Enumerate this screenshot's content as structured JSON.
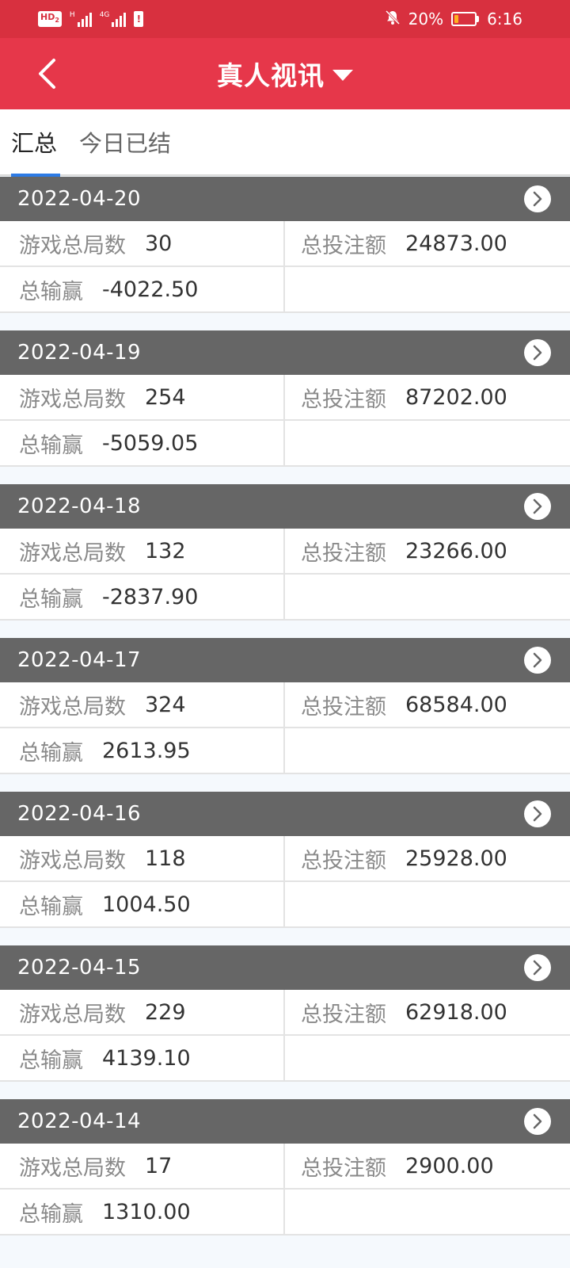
{
  "statusbar": {
    "hd": "HD",
    "hd_sub": "2",
    "signal1_label": "H",
    "signal2_label": "4G",
    "battery_percent": "20%",
    "battery_level": 0.2,
    "time": "6:16"
  },
  "header": {
    "title": "真人视讯"
  },
  "tabs": [
    {
      "label": "汇总"
    },
    {
      "label": "今日已结"
    }
  ],
  "labels": {
    "rounds": "游戏总局数",
    "bet": "总投注额",
    "winloss": "总输赢"
  },
  "records": [
    {
      "date": "2022-04-20",
      "rounds": "30",
      "bet": "24873.00",
      "winloss": "-4022.50"
    },
    {
      "date": "2022-04-19",
      "rounds": "254",
      "bet": "87202.00",
      "winloss": "-5059.05"
    },
    {
      "date": "2022-04-18",
      "rounds": "132",
      "bet": "23266.00",
      "winloss": "-2837.90"
    },
    {
      "date": "2022-04-17",
      "rounds": "324",
      "bet": "68584.00",
      "winloss": "2613.95"
    },
    {
      "date": "2022-04-16",
      "rounds": "118",
      "bet": "25928.00",
      "winloss": "1004.50"
    },
    {
      "date": "2022-04-15",
      "rounds": "229",
      "bet": "62918.00",
      "winloss": "4139.10"
    },
    {
      "date": "2022-04-14",
      "rounds": "17",
      "bet": "2900.00",
      "winloss": "1310.00"
    }
  ]
}
